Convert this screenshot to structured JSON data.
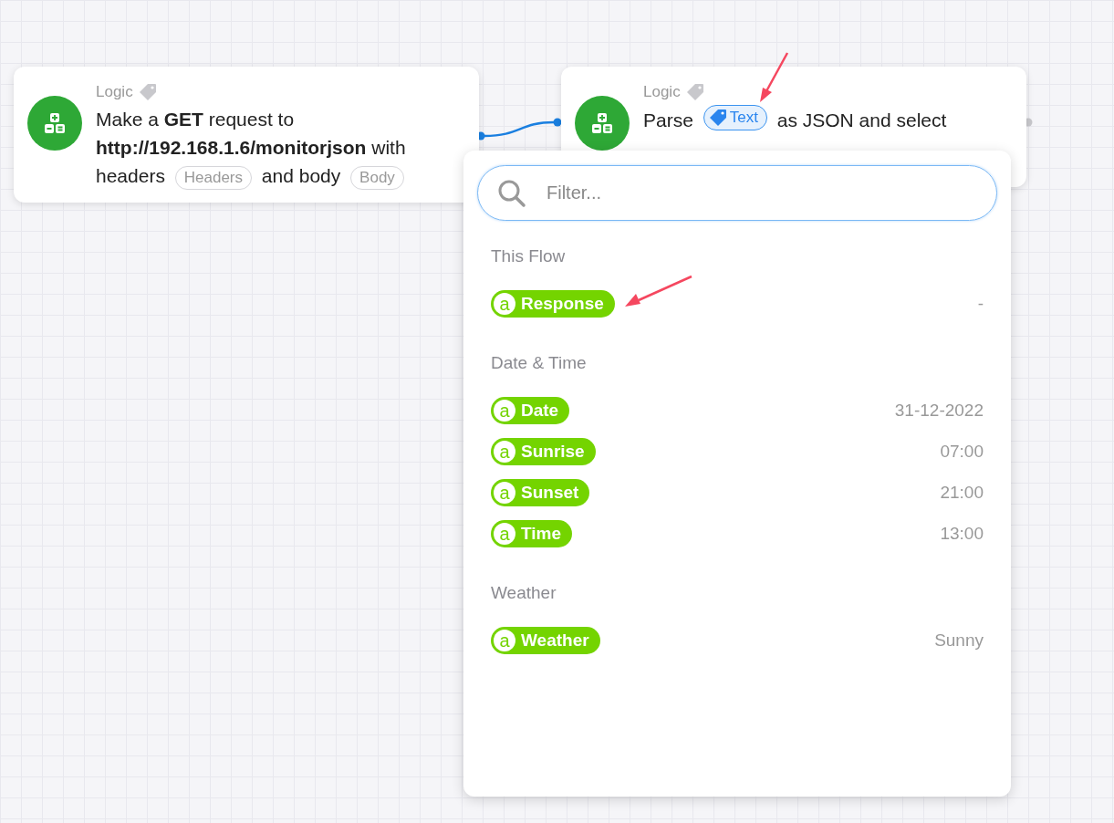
{
  "nodes": [
    {
      "category": "Logic",
      "segments": [
        {
          "kind": "text",
          "text": "Make a **GET** request to"
        },
        {
          "kind": "text",
          "text": "**http://192.168.1.6/monitorjson** with"
        },
        {
          "kind": "text",
          "text": "headers"
        },
        {
          "kind": "chip",
          "text": "Headers"
        },
        {
          "kind": "text",
          "text": "and body"
        },
        {
          "kind": "chip",
          "text": "Body"
        }
      ]
    },
    {
      "category": "Logic",
      "segments": [
        {
          "kind": "text",
          "text": "Parse"
        },
        {
          "kind": "tag",
          "text": "Text"
        },
        {
          "kind": "text",
          "text": "as JSON and select"
        }
      ]
    }
  ],
  "picker": {
    "search": {
      "placeholder": "Filter..."
    },
    "sections": [
      {
        "title": "This Flow",
        "items": [
          {
            "glyph": "a",
            "label": "Response",
            "value": "-"
          }
        ]
      },
      {
        "title": "Date & Time",
        "items": [
          {
            "glyph": "a",
            "label": "Date",
            "value": "31-12-2022"
          },
          {
            "glyph": "a",
            "label": "Sunrise",
            "value": "07:00"
          },
          {
            "glyph": "a",
            "label": "Sunset",
            "value": "21:00"
          },
          {
            "glyph": "a",
            "label": "Time",
            "value": "13:00"
          }
        ]
      },
      {
        "title": "Weather",
        "items": [
          {
            "glyph": "a",
            "label": "Weather",
            "value": "Sunny"
          }
        ]
      }
    ]
  }
}
